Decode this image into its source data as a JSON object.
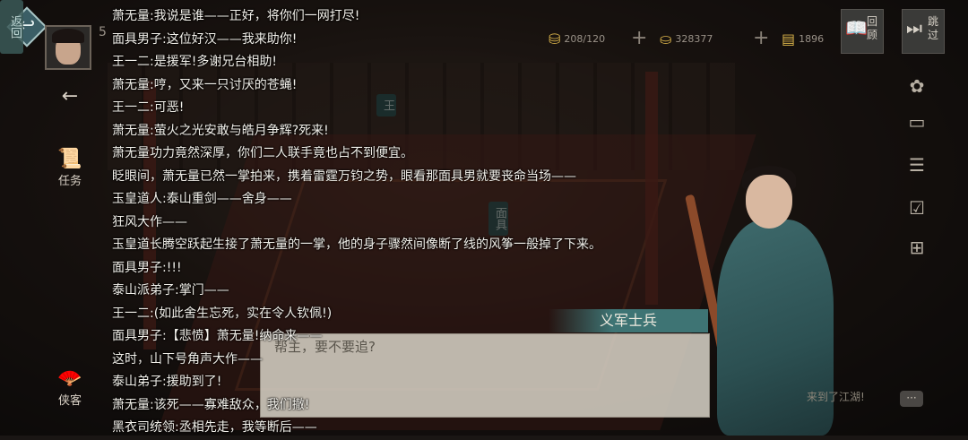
{
  "hud": {
    "back_icon": "return-arrow-icon",
    "level_partial": "5",
    "resources": [
      {
        "icon": "ingot-icon",
        "value": "208/120"
      },
      {
        "icon": "gold-ingot-icon",
        "value": "328377"
      },
      {
        "icon": "gold-bars-icon",
        "value": "1896"
      }
    ],
    "review_button": {
      "icon": "scroll-icon",
      "label": "回顾"
    },
    "skip_button": {
      "icon": "fast-forward-icon",
      "label": "跳过"
    },
    "left_buttons": [
      {
        "icon": "left-arrow-icon",
        "label": ""
      },
      {
        "icon": "scroll-icon",
        "label": "任务"
      },
      {
        "icon": "fan-icon",
        "label": "侠客"
      }
    ]
  },
  "scene": {
    "npc_tags": [
      "王",
      "面具"
    ],
    "return_tag": "返回"
  },
  "dialogue": {
    "speaker": "义军士兵",
    "text": "帮主，要不要追?"
  },
  "chat": {
    "hint": "来到了江湖!"
  },
  "log": [
    "萧无量:我说是谁——正好，将你们一网打尽!",
    "面具男子:这位好汉——我来助你!",
    "王一二:是援军!多谢兄台相助!",
    "萧无量:哼，又来一只讨厌的苍蝇!",
    "王一二:可恶!",
    "萧无量:萤火之光安敢与皓月争辉?死来!",
    "萧无量功力竟然深厚，你们二人联手竟也占不到便宜。",
    "眨眼间，萧无量已然一掌拍来，携着雷霆万钧之势，眼看那面具男就要丧命当场——",
    "玉皇道人:泰山重剑——舍身——",
    "狂风大作——",
    "玉皇道长腾空跃起生接了萧无量的一掌，他的身子骤然间像断了线的风筝一般掉了下来。",
    "面具男子:!!!",
    "泰山派弟子:掌门——",
    "王一二:(如此舍生忘死，实在令人钦佩!)",
    "面具男子:【悲愤】萧无量!纳命来——",
    "这时，山下号角声大作——",
    "泰山弟子:援助到了!",
    "萧无量:该死——寡难敌众，我们撤!",
    "黑衣司统领:丞相先走，我等断后——"
  ]
}
